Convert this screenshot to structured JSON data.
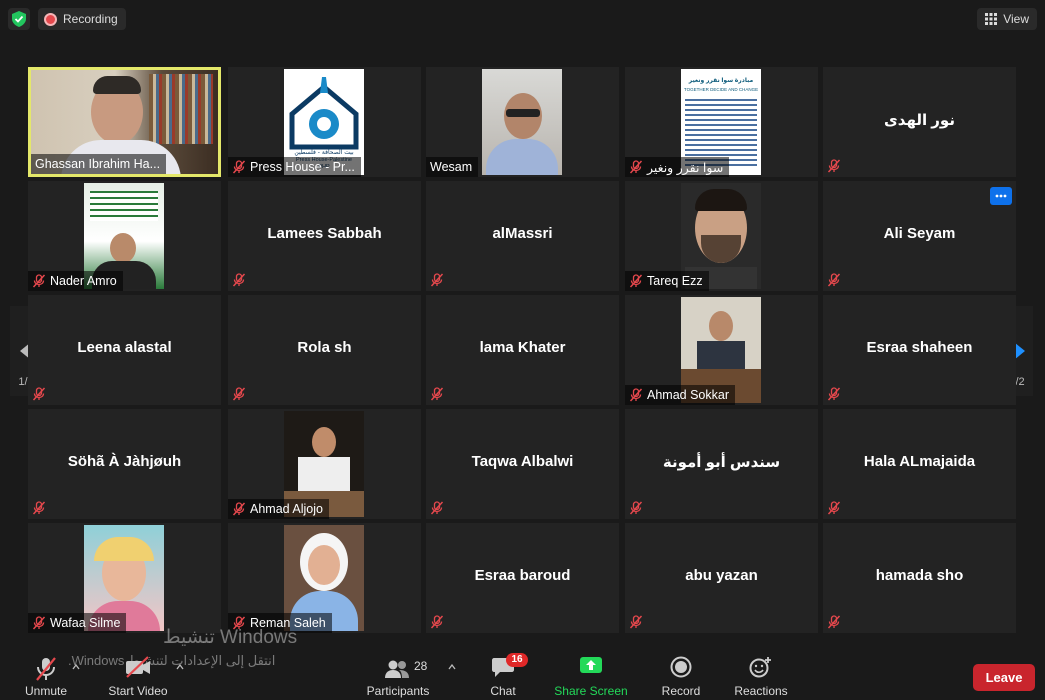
{
  "topbar": {
    "recording_label": "Recording",
    "view_label": "View"
  },
  "participants_grid": {
    "page_indicator": "1/2",
    "tiles": [
      {
        "name": "Ghassan Ibrahim Ha...",
        "type": "video",
        "active": true,
        "muted": false
      },
      {
        "name": "Press House - Pr...",
        "type": "image",
        "muted": true,
        "logo_text": "بيت الصحافة - فلسطين",
        "logo_sub": "Press House-Palestine",
        "logo_tag": "PHP"
      },
      {
        "name": "Wesam",
        "type": "video",
        "muted": false
      },
      {
        "name": "سوا نقرر ونغير",
        "type": "image",
        "muted": true,
        "poster_title": "مبادرة سوا نقرر ونغير",
        "poster_sub": "TOGETHER DECIDE AND CHANGE"
      },
      {
        "name": "نور الهدى",
        "type": "name",
        "muted": true
      },
      {
        "name": "Nader Amro",
        "type": "video",
        "muted": true
      },
      {
        "name": "Lamees Sabbah",
        "type": "name",
        "muted": true
      },
      {
        "name": "alMassri",
        "type": "name",
        "muted": true
      },
      {
        "name": "Tareq Ezz",
        "type": "image",
        "muted": true
      },
      {
        "name": "Ali Seyam",
        "type": "name",
        "muted": true,
        "more": true
      },
      {
        "name": "Leena alastal",
        "type": "name",
        "muted": true
      },
      {
        "name": "Rola sh",
        "type": "name",
        "muted": true
      },
      {
        "name": "lama Khater",
        "type": "name",
        "muted": true
      },
      {
        "name": "Ahmad Sokkar",
        "type": "image",
        "muted": true
      },
      {
        "name": "Esraa shaheen",
        "type": "name",
        "muted": true
      },
      {
        "name": "Söhã À Jàhjøuh",
        "type": "name",
        "muted": true
      },
      {
        "name": "Ahmad Aljojo",
        "type": "image",
        "muted": true
      },
      {
        "name": "Taqwa Albalwi",
        "type": "name",
        "muted": true
      },
      {
        "name": "سندس أبو أمونة",
        "type": "name",
        "muted": true
      },
      {
        "name": "Hala ALmajaida",
        "type": "name",
        "muted": true
      },
      {
        "name": "Wafaa Silme",
        "type": "image",
        "muted": true
      },
      {
        "name": "Reman Saleh",
        "type": "image",
        "muted": true
      },
      {
        "name": "Esraa baroud",
        "type": "name",
        "muted": true
      },
      {
        "name": "abu yazan",
        "type": "name",
        "muted": true
      },
      {
        "name": "hamada sho",
        "type": "name",
        "muted": true
      }
    ]
  },
  "watermark": {
    "line1": "Windows تنشيط",
    "line2": "انتقل إلى الإعدادات لتنشيط Windows."
  },
  "toolbar": {
    "unmute": "Unmute",
    "start_video": "Start Video",
    "participants": "Participants",
    "participants_count": "28",
    "chat": "Chat",
    "chat_badge": "16",
    "share_screen": "Share Screen",
    "record": "Record",
    "reactions": "Reactions",
    "leave": "Leave"
  },
  "colors": {
    "accent_blue": "#0e71eb",
    "share_green": "#23d959",
    "leave_red": "#c9252d",
    "active_border": "#e4e86a",
    "mute_red": "#e5484d"
  }
}
